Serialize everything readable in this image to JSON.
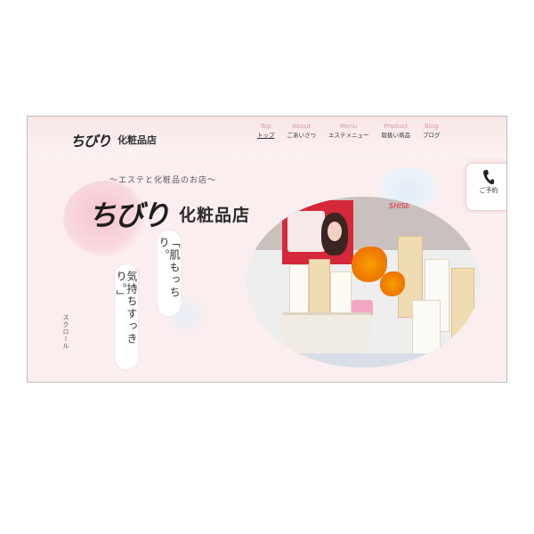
{
  "header": {
    "logo_script": "ちびり",
    "logo_text": "化粧品店",
    "nav": [
      {
        "en": "Top",
        "jp": "トップ"
      },
      {
        "en": "About",
        "jp": "ごあいさつ"
      },
      {
        "en": "Menu",
        "jp": "エステメニュー"
      },
      {
        "en": "Product",
        "jp": "取扱い商品"
      },
      {
        "en": "Blog",
        "jp": "ブログ"
      }
    ]
  },
  "reserve": {
    "label": "ご予約",
    "icon": "phone-icon"
  },
  "hero": {
    "tagline": "〜エステと化粧品のお店〜",
    "logo_script": "ちびり",
    "logo_text": "化粧品店",
    "catch1": "「肌もっちり。",
    "catch2": "気持ちすっきり。」",
    "scroll_label": "スクロール",
    "photo_sign_text": "SHISE"
  },
  "colors": {
    "accent_pink": "#d49aa6",
    "header_bg": "#f8e6e6",
    "page_bg": "#fbeeee"
  }
}
